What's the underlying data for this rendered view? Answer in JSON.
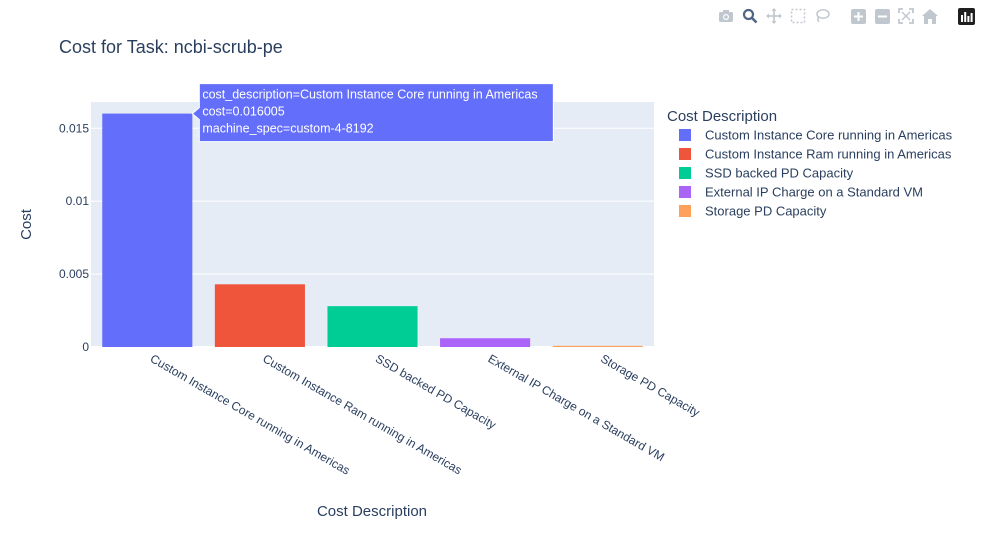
{
  "modebar": {
    "buttons": [
      {
        "name": "download-plot-button",
        "icon": "camera-icon"
      },
      {
        "name": "zoom-button",
        "icon": "zoom-icon"
      },
      {
        "name": "pan-button",
        "icon": "pan-icon"
      },
      {
        "name": "box-select-button",
        "icon": "box-select-icon"
      },
      {
        "name": "lasso-select-button",
        "icon": "lasso-icon"
      },
      {
        "name": "zoom-in-button",
        "icon": "plus-box-icon"
      },
      {
        "name": "zoom-out-button",
        "icon": "minus-box-icon"
      },
      {
        "name": "autoscale-button",
        "icon": "autoscale-icon"
      },
      {
        "name": "reset-axes-button",
        "icon": "home-icon"
      },
      {
        "name": "plotly-logo-button",
        "icon": "plotly-logo-icon"
      }
    ]
  },
  "chart_data": {
    "type": "bar",
    "title": "Cost for Task: ncbi-scrub-pe",
    "xlabel": "Cost Description",
    "ylabel": "Cost",
    "ylim": [
      0,
      0.0168
    ],
    "yticks": [
      0,
      0.005,
      0.01,
      0.015
    ],
    "ytick_labels": [
      "0",
      "0.005",
      "0.01",
      "0.015"
    ],
    "grid": true,
    "legend_title": "Cost Description",
    "legend_position": "right",
    "categories": [
      "Custom Instance Core running in Americas",
      "Custom Instance Ram running in Americas",
      "SSD backed PD Capacity",
      "External IP Charge on a Standard VM",
      "Storage PD Capacity"
    ],
    "values": [
      0.016005,
      0.0043,
      0.0028,
      0.0006,
      8e-05
    ],
    "colors": [
      "#636efa",
      "#EF553B",
      "#00cc96",
      "#ab63fa",
      "#FFA15A"
    ],
    "plot_bg": "#e5ecf6",
    "hover": {
      "bar_index": 0,
      "lines": [
        "cost_description=Custom Instance Core running in Americas",
        "cost=0.016005",
        "machine_spec=custom-4-8192"
      ]
    }
  }
}
